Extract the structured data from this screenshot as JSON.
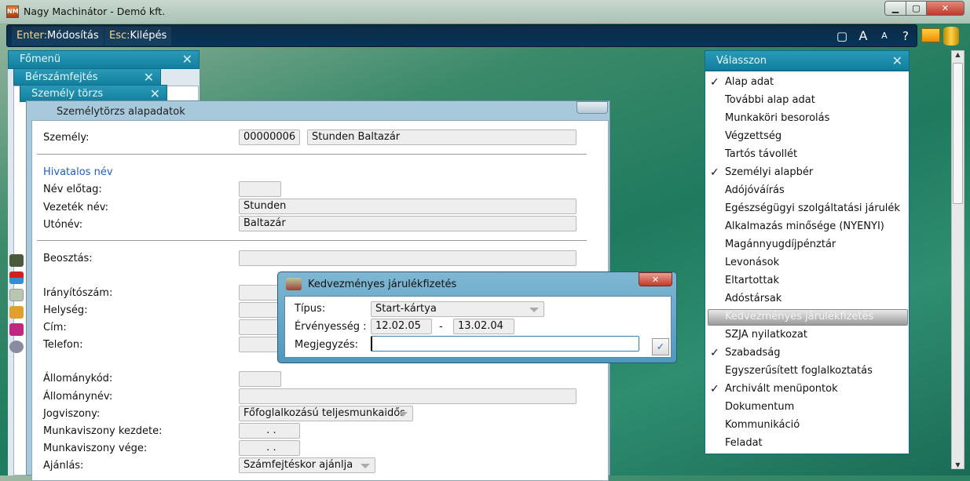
{
  "window": {
    "title": "Nagy Machinátor - Demó kft.",
    "logo": "NM",
    "minimize": "▁",
    "maximize": "▢",
    "close": "✕"
  },
  "toolbar": {
    "enter_key": "Enter:",
    "enter_label": "Módosítás",
    "esc_key": "Esc:",
    "esc_label": "Kilépés",
    "right_buttons": [
      "▢",
      "A",
      "A",
      "?"
    ]
  },
  "panels": {
    "fomenu": "Főmenü",
    "berszamfejtes": "Bérszámfejtés",
    "szemely_torzs": "Személy törzs",
    "close": "✕"
  },
  "main": {
    "title": "Személytörzs alapadatok",
    "szemely_label": "Személy:",
    "szemely_id": "00000006",
    "szemely_name": "Stunden Baltazár",
    "section_hivatalos": "Hivatalos név",
    "nev_elotag_label": "Név előtag:",
    "nev_elotag": "",
    "vezetek_label": "Vezeték név:",
    "vezetek": "Stunden",
    "utonev_label": "Utónév:",
    "utonev": "Baltazár",
    "beosztas_label": "Beosztás:",
    "beosztas": "",
    "iranyito_label": "Irányítószám:",
    "helyseg_label": "Helység:",
    "cim_label": "Cím:",
    "telefon_label": "Telefon:",
    "allomanykod_label": "Állománykód:",
    "allomanynev_label": "Állománynév:",
    "jogviszony_label": "Jogviszony:",
    "jogviszony": "Főfoglalkozású teljesmunkaidős",
    "mv_kezdete_label": "Munkaviszony kezdete:",
    "mv_kezdete": ". .",
    "mv_vege_label": "Munkaviszony vége:",
    "mv_vege": ". .",
    "ajanlas_label": "Ajánlás:",
    "ajanlas": "Számfejtéskor ajánlja"
  },
  "modal": {
    "title": "Kedvezményes járulékfizetés",
    "close": "✕",
    "tipus_label": "Típus:",
    "tipus": "Start-kártya",
    "ervenyesseg_label": "Érvényesség :",
    "from": "12.02.05",
    "dash": "-",
    "to": "13.02.04",
    "megjegyzes_label": "Megjegyzés:",
    "megjegyzes": "",
    "ok": "✓"
  },
  "right": {
    "title": "Válasszon",
    "close": "✕",
    "items": [
      {
        "label": "Alap adat",
        "checked": true
      },
      {
        "label": "További alap adat",
        "checked": false
      },
      {
        "label": "Munkaköri besorolás",
        "checked": false
      },
      {
        "label": "Végzettség",
        "checked": false
      },
      {
        "label": "Tartós távollét",
        "checked": false
      },
      {
        "label": "Személyi alapbér",
        "checked": true
      },
      {
        "label": "Adójóváírás",
        "checked": false
      },
      {
        "label": "Egészségügyi szolgáltatási járulék",
        "checked": false
      },
      {
        "label": "Alkalmazás minősége (NYENYI)",
        "checked": false
      },
      {
        "label": "Magánnyugdíjpénztár",
        "checked": false
      },
      {
        "label": "Levonások",
        "checked": false
      },
      {
        "label": "Eltartottak",
        "checked": false
      },
      {
        "label": "Adóstársak",
        "checked": false
      },
      {
        "label": "Kedvezményes járulékfizetés",
        "checked": false,
        "selected": true
      },
      {
        "label": "SZJA nyilatkozat",
        "checked": false
      },
      {
        "label": "Szabadság",
        "checked": true
      },
      {
        "label": "Egyszerűsített foglalkoztatás",
        "checked": false
      },
      {
        "label": "Archivált menüpontok",
        "checked": true
      },
      {
        "label": "Dokumentum",
        "checked": false
      },
      {
        "label": "Kommunikáció",
        "checked": false
      },
      {
        "label": "Feladat",
        "checked": false
      }
    ],
    "check": "✓"
  },
  "colors": {
    "toolbar": "#06355a",
    "panel_header": "#1a8cad",
    "accent_blue": "#1f5fbf"
  }
}
